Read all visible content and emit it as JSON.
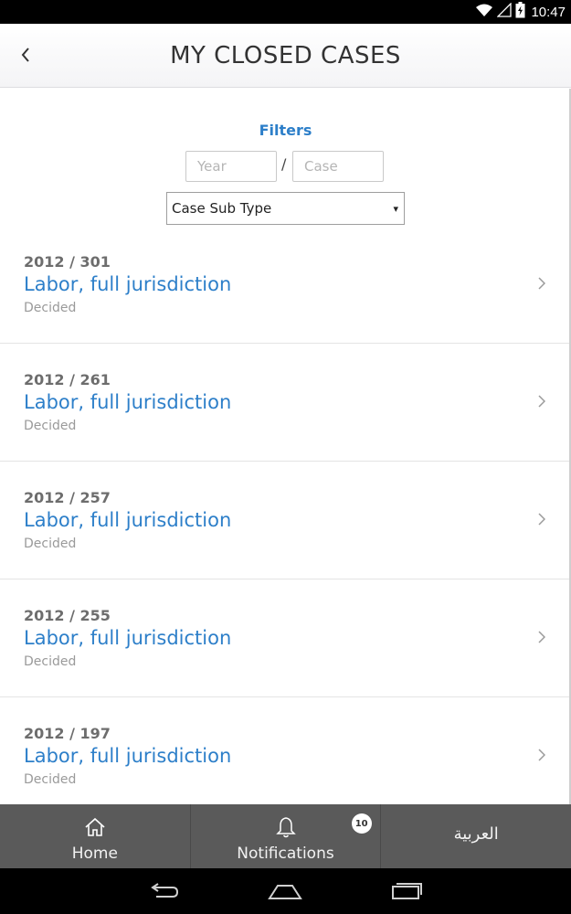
{
  "status_bar": {
    "time": "10:47",
    "icons": [
      "wifi-icon",
      "signal-icon",
      "battery-icon"
    ]
  },
  "header": {
    "title": "MY CLOSED CASES",
    "back_icon": "chevron-left-icon"
  },
  "filters": {
    "title": "Filters",
    "year_placeholder": "Year",
    "separator": "/",
    "case_placeholder": "Case",
    "subtype_selected": "Case Sub Type",
    "subtype_arrow": "▾"
  },
  "cases": [
    {
      "number": "2012 / 301",
      "type": "Labor, full jurisdiction",
      "status": "Decided"
    },
    {
      "number": "2012 / 261",
      "type": "Labor, full jurisdiction",
      "status": "Decided"
    },
    {
      "number": "2012 / 257",
      "type": "Labor, full jurisdiction",
      "status": "Decided"
    },
    {
      "number": "2012 / 255",
      "type": "Labor, full jurisdiction",
      "status": "Decided"
    },
    {
      "number": "2012 / 197",
      "type": "Labor, full jurisdiction",
      "status": "Decided"
    }
  ],
  "bottom_nav": {
    "home_label": "Home",
    "notifications_label": "Notifications",
    "notifications_count": "10",
    "language_label": "العربية"
  },
  "colors": {
    "accent": "#2d7fc9",
    "nav_bg": "#5a5a5a",
    "title": "#333333"
  }
}
